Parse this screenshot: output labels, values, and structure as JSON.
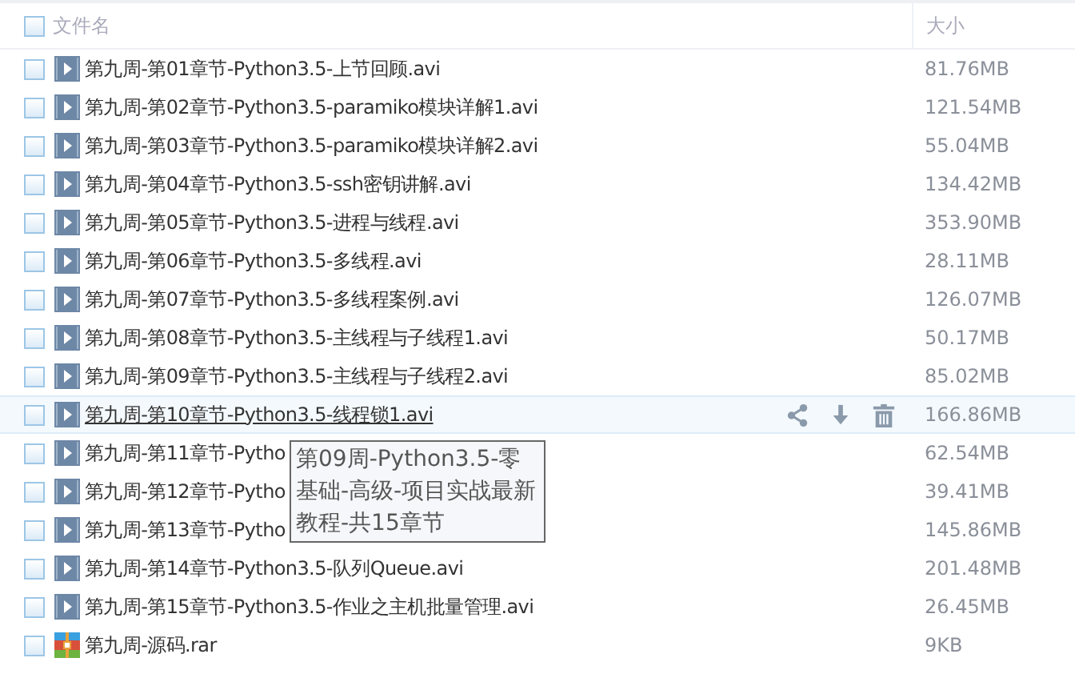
{
  "header": {
    "checked": false,
    "name_column": "文件名",
    "size_column": "大小"
  },
  "files": [
    {
      "kind": "video",
      "name": "第九周-第01章节-Python3.5-上节回顾.avi",
      "size": "81.76MB",
      "checked": false,
      "hovered": false
    },
    {
      "kind": "video",
      "name": "第九周-第02章节-Python3.5-paramiko模块详解1.avi",
      "size": "121.54MB",
      "checked": false,
      "hovered": false
    },
    {
      "kind": "video",
      "name": "第九周-第03章节-Python3.5-paramiko模块详解2.avi",
      "size": "55.04MB",
      "checked": false,
      "hovered": false
    },
    {
      "kind": "video",
      "name": "第九周-第04章节-Python3.5-ssh密钥讲解.avi",
      "size": "134.42MB",
      "checked": false,
      "hovered": false
    },
    {
      "kind": "video",
      "name": "第九周-第05章节-Python3.5-进程与线程.avi",
      "size": "353.90MB",
      "checked": false,
      "hovered": false
    },
    {
      "kind": "video",
      "name": "第九周-第06章节-Python3.5-多线程.avi",
      "size": "28.11MB",
      "checked": false,
      "hovered": false
    },
    {
      "kind": "video",
      "name": "第九周-第07章节-Python3.5-多线程案例.avi",
      "size": "126.07MB",
      "checked": false,
      "hovered": false
    },
    {
      "kind": "video",
      "name": "第九周-第08章节-Python3.5-主线程与子线程1.avi",
      "size": "50.17MB",
      "checked": false,
      "hovered": false
    },
    {
      "kind": "video",
      "name": "第九周-第09章节-Python3.5-主线程与子线程2.avi",
      "size": "85.02MB",
      "checked": false,
      "hovered": false
    },
    {
      "kind": "video",
      "name": "第九周-第10章节-Python3.5-线程锁1.avi",
      "size": "166.86MB",
      "checked": false,
      "hovered": true
    },
    {
      "kind": "video",
      "name": "第九周-第11章节-Pytho",
      "size": "62.54MB",
      "checked": false,
      "hovered": false
    },
    {
      "kind": "video",
      "name": "第九周-第12章节-Pytho",
      "size": "39.41MB",
      "checked": false,
      "hovered": false
    },
    {
      "kind": "video",
      "name": "第九周-第13章节-Pytho",
      "size": "145.86MB",
      "checked": false,
      "hovered": false
    },
    {
      "kind": "video",
      "name": "第九周-第14章节-Python3.5-队列Queue.avi",
      "size": "201.48MB",
      "checked": false,
      "hovered": false
    },
    {
      "kind": "video",
      "name": "第九周-第15章节-Python3.5-作业之主机批量管理.avi",
      "size": "26.45MB",
      "checked": false,
      "hovered": false
    },
    {
      "kind": "archive",
      "name": "第九周-源码.rar",
      "size": "9KB",
      "checked": false,
      "hovered": false
    }
  ],
  "tooltip": {
    "text": "第09周-Python3.5-零基础-高级-项目实战最新教程-共15章节"
  }
}
